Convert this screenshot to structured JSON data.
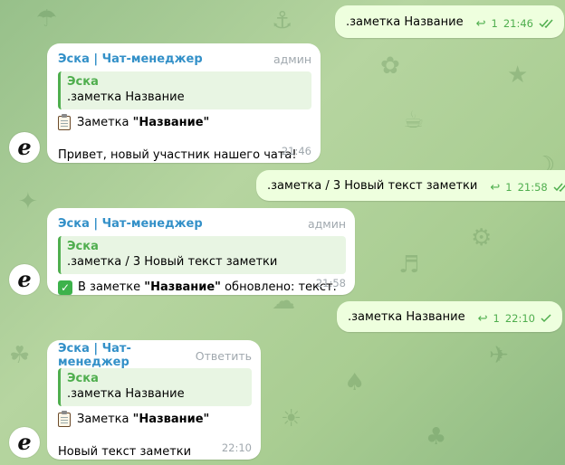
{
  "theme": {
    "outgoing_bg": "#eeffde",
    "incoming_bg": "#ffffff",
    "accent_green": "#4fae4e",
    "sender_blue": "#3390c8",
    "meta_gray": "#a0a8ae"
  },
  "bot": {
    "name": "Эска | Чат-менеджер",
    "avatar_icon": "bot-avatar-icon",
    "avatar_letter": "e"
  },
  "messages": [
    {
      "type": "outgoing",
      "text": ".заметка Название",
      "reply_count": "1",
      "time": "21:46",
      "status": "double-check-icon"
    },
    {
      "type": "incoming",
      "role": "админ",
      "quote_author": "Эска",
      "quote_text": ".заметка Название",
      "line1_prefix": "Заметка ",
      "line1_bold": "\"Название\"",
      "line1_suffix": "",
      "line1_emoji": "clipboard-icon",
      "body": "Привет, новый участник нашего чата!",
      "time": "21:46"
    },
    {
      "type": "outgoing",
      "text": ".заметка / 3 Новый текст заметки",
      "reply_count": "1",
      "time": "21:58",
      "status": "double-check-icon"
    },
    {
      "type": "incoming",
      "role": "админ",
      "quote_author": "Эска",
      "quote_text": ".заметка / 3 Новый текст заметки",
      "line1_prefix": "В заметке ",
      "line1_bold": "\"Название\"",
      "line1_suffix": " обновлено: текст.",
      "line1_emoji": "check-mark-button-icon",
      "time": "21:58"
    },
    {
      "type": "outgoing",
      "text": ".заметка Название",
      "reply_count": "1",
      "time": "22:10",
      "status": "single-check-icon"
    },
    {
      "type": "incoming",
      "role": "Ответить",
      "quote_author": "Эска",
      "quote_text": ".заметка Название",
      "line1_prefix": "Заметка ",
      "line1_bold": "\"Название\"",
      "line1_suffix": "",
      "line1_emoji": "clipboard-icon",
      "body": "Новый текст заметки",
      "time": "22:10"
    }
  ]
}
